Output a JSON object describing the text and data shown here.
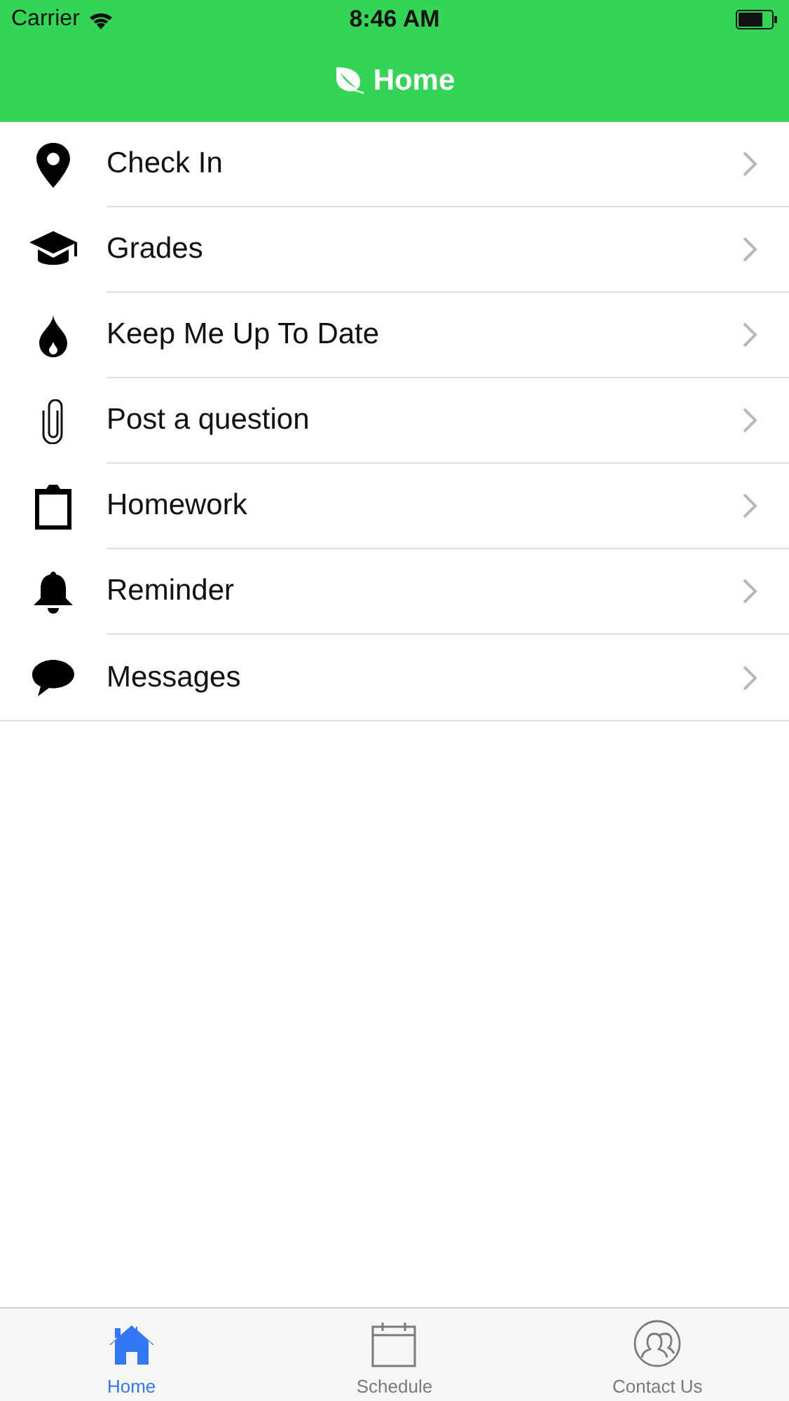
{
  "status_bar": {
    "carrier": "Carrier",
    "time": "8:46 AM"
  },
  "nav_bar": {
    "title": "Home"
  },
  "menu": [
    {
      "kind": "pin",
      "label": "Check In"
    },
    {
      "kind": "cap",
      "label": "Grades"
    },
    {
      "kind": "flame",
      "label": "Keep Me Up To Date"
    },
    {
      "kind": "clip",
      "label": "Post a question"
    },
    {
      "kind": "clipboard",
      "label": "Homework"
    },
    {
      "kind": "bell",
      "label": "Reminder"
    },
    {
      "kind": "chat",
      "label": "Messages"
    }
  ],
  "tab_bar": [
    {
      "kind": "home",
      "label": "Home",
      "selected": true
    },
    {
      "kind": "calendar",
      "label": "Schedule",
      "selected": false
    },
    {
      "kind": "people",
      "label": "Contact Us",
      "selected": false
    }
  ]
}
